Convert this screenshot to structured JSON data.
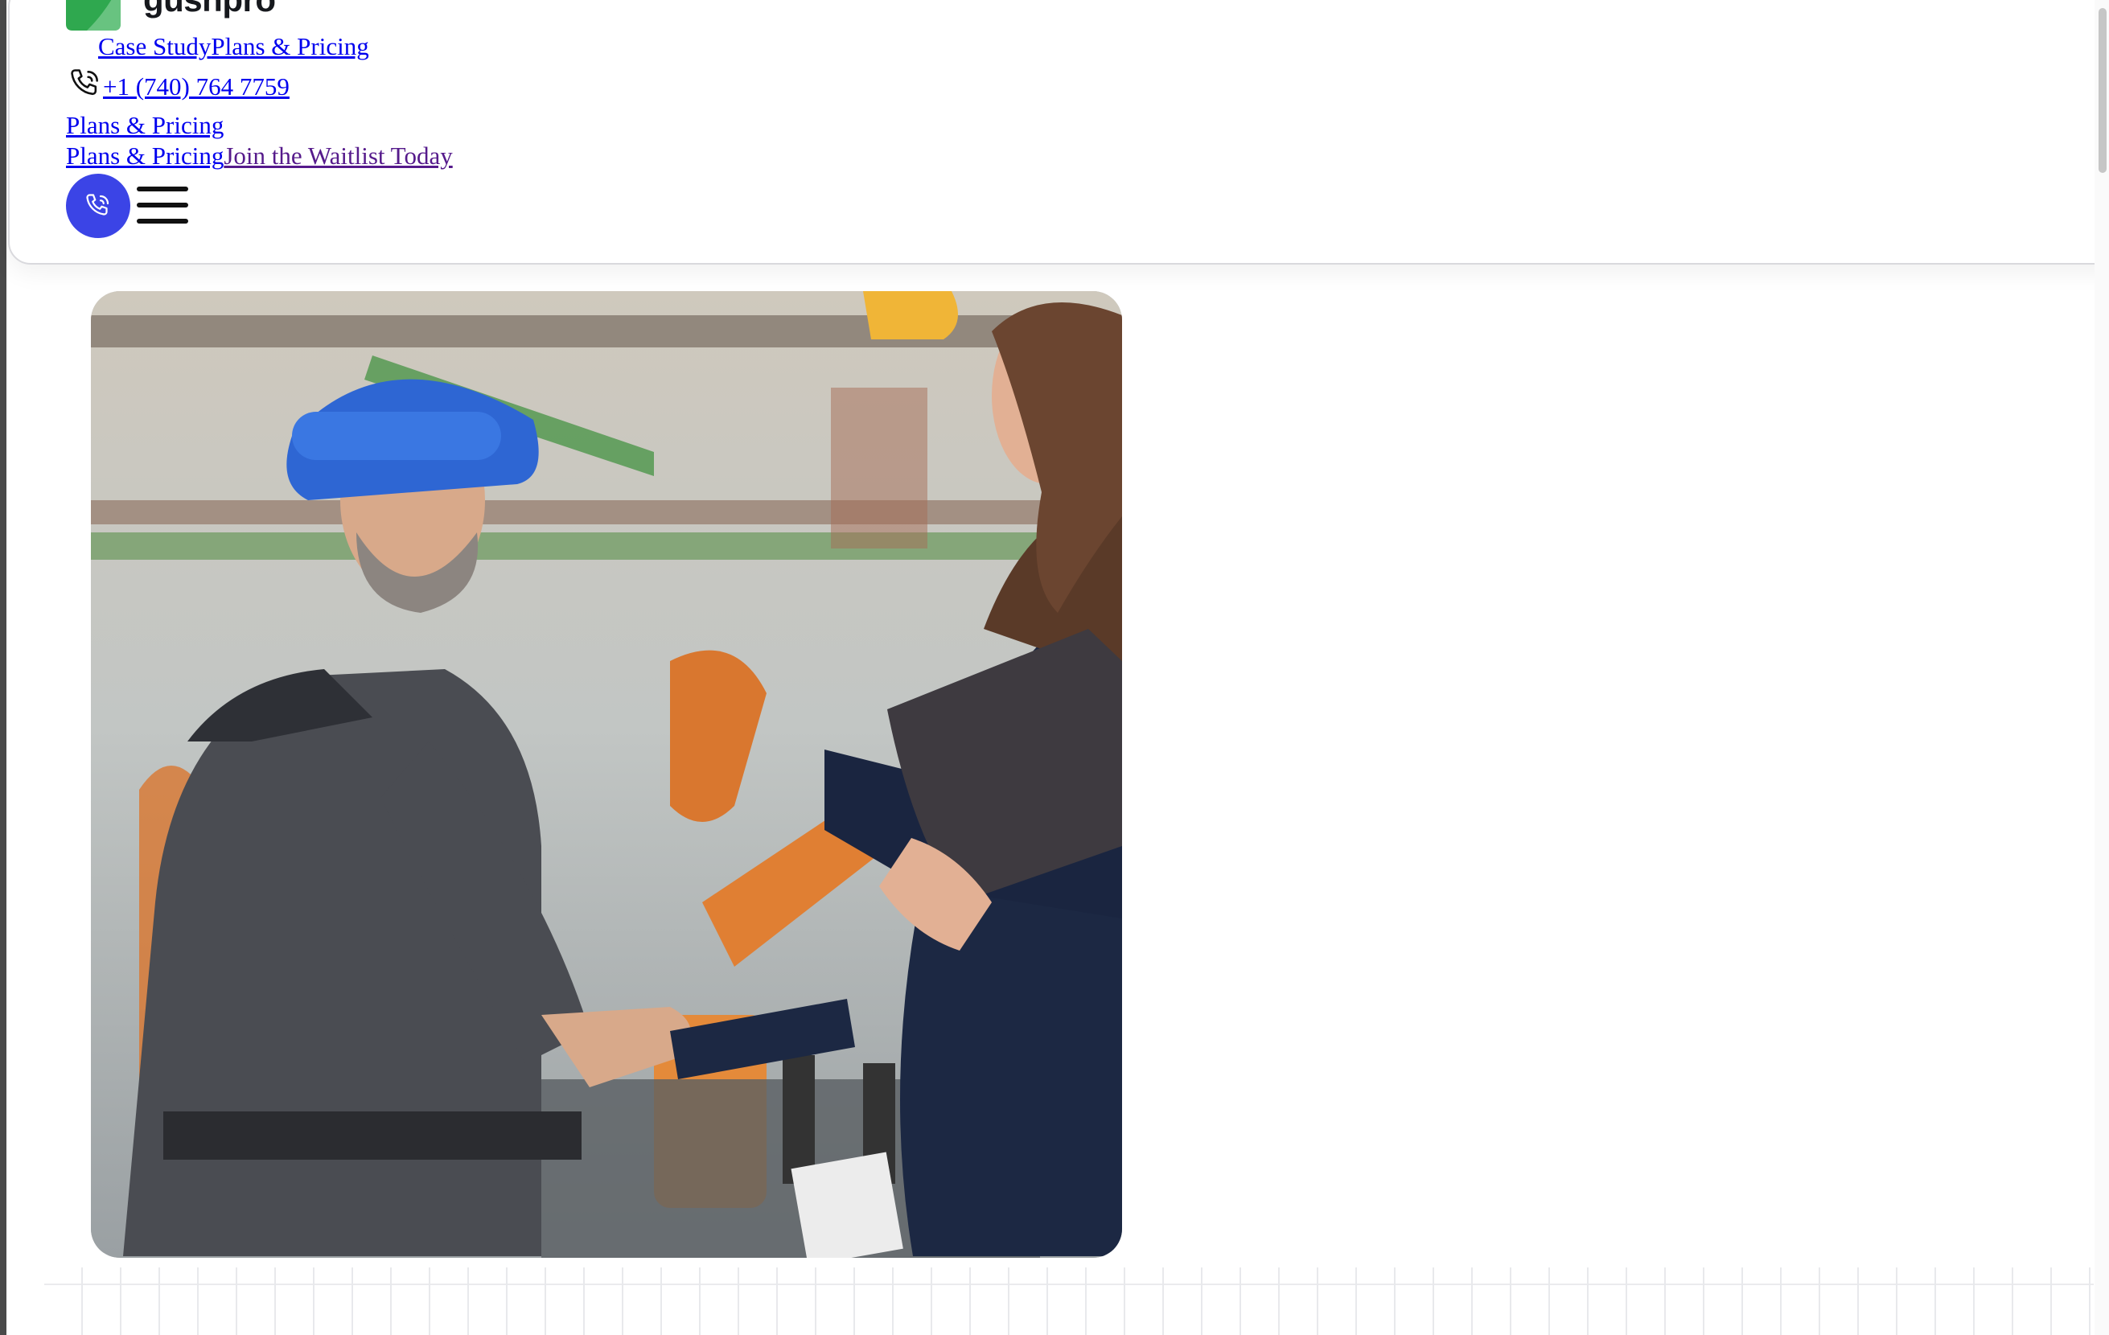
{
  "brand": {
    "name": "gushpro",
    "logo_green": "#2fa84f",
    "logo_green_light": "#53c878"
  },
  "nav": {
    "case_study": "Case Study",
    "plans_pricing": "Plans & Pricing"
  },
  "contact": {
    "phone": "+1 (740) 764 7759"
  },
  "links": {
    "plans_pricing_2": "Plans & Pricing",
    "plans_pricing_3": "Plans & Pricing",
    "join_waitlist": "Join the Waitlist Today"
  },
  "buttons": {
    "call_icon": "phone-icon",
    "menu_icon": "hamburger-menu-icon",
    "call_color": "#3b44e6"
  },
  "hero": {
    "description_icon": "image"
  }
}
